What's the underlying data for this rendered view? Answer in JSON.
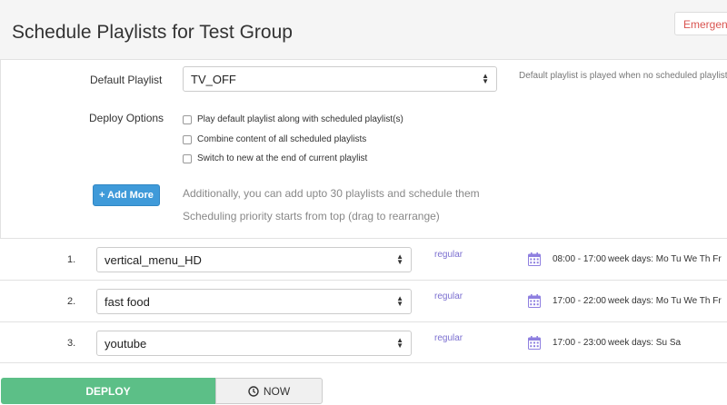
{
  "header": {
    "title": "Schedule Playlists for Test Group",
    "emergency_label": "Emergency"
  },
  "settings": {
    "default_playlist_label": "Default Playlist",
    "default_playlist_value": "TV_OFF",
    "default_playlist_help": "Default playlist is played when no scheduled playlists ar",
    "deploy_options_label": "Deploy Options",
    "options": [
      {
        "label": "Play default playlist along with scheduled playlist(s)",
        "checked": false
      },
      {
        "label": "Combine content of all scheduled playlists",
        "checked": false
      },
      {
        "label": "Switch to new at the end of current playlist",
        "checked": false
      }
    ],
    "add_more_label": "+ Add More",
    "info_line_1": "Additionally, you can add upto 30 playlists and schedule them",
    "info_line_2": "Scheduling priority starts from top (drag to rearrange)"
  },
  "schedule": [
    {
      "number": "1.",
      "playlist": "vertical_menu_HD",
      "type": "regular",
      "time": "08:00 - 17:00",
      "days": "week days: Mo Tu We Th Fr"
    },
    {
      "number": "2.",
      "playlist": "fast food",
      "type": "regular",
      "time": "17:00 - 22:00",
      "days": "week days: Mo Tu We Th Fr"
    },
    {
      "number": "3.",
      "playlist": "youtube",
      "type": "regular",
      "time": "17:00 - 23:00",
      "days": "week days: Su Sa"
    }
  ],
  "footer": {
    "deploy_label": "DEPLOY",
    "now_label": "NOW"
  },
  "colors": {
    "deploy": "#5cbf87",
    "add_more": "#3f9ad9",
    "tag": "#7b6fd0",
    "calendar": "#8e7fe0",
    "emergency_text": "#d9534f"
  },
  "icons": {
    "calendar": "calendar-icon",
    "clock": "clock-icon",
    "select_arrows": "select-arrows-icon"
  }
}
